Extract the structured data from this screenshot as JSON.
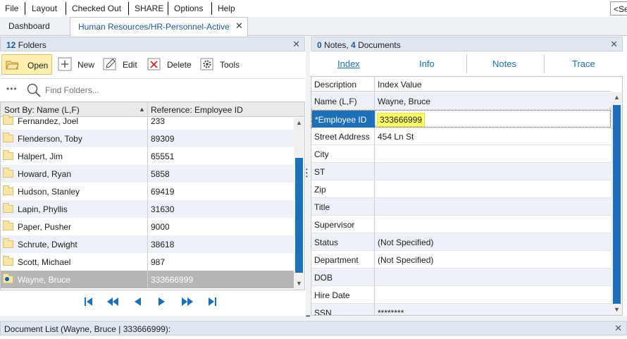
{
  "menu": [
    "File",
    "Layout",
    "Checked Out",
    "SHARE",
    "Options",
    "Help"
  ],
  "search_stub": "<Se",
  "tabs": {
    "dashboard": "Dashboard",
    "active": "Human Resources/HR-Personnel-Active",
    "close": "✕"
  },
  "folders_panel": {
    "count": "12",
    "label": " Folders",
    "close": "✕"
  },
  "toolbar": {
    "open": "Open",
    "new": "New",
    "edit": "Edit",
    "delete": "Delete",
    "tools": "Tools"
  },
  "find": {
    "dots": "•••",
    "placeholder": "Find Folders..."
  },
  "grid": {
    "col1": "Sort By: Name (L,F)",
    "col2": "Reference: Employee ID",
    "rows": [
      {
        "name": "Fernandez, Joel",
        "id": "233"
      },
      {
        "name": "Flenderson, Toby",
        "id": "89309"
      },
      {
        "name": "Halpert, Jim",
        "id": "65551"
      },
      {
        "name": "Howard, Ryan",
        "id": "5858"
      },
      {
        "name": "Hudson, Stanley",
        "id": "69419"
      },
      {
        "name": "Lapin, Phyllis",
        "id": "31630"
      },
      {
        "name": "Paper, Pusher",
        "id": "9000"
      },
      {
        "name": "Schrute, Dwight",
        "id": "38618"
      },
      {
        "name": "Scott, Michael",
        "id": "987"
      },
      {
        "name": "Wayne, Bruce",
        "id": "333666999"
      }
    ]
  },
  "pager": {
    "first": "⇤",
    "prev_page": "«",
    "prev": "◀",
    "next": "▶",
    "next_page": "»",
    "last": "⇥"
  },
  "right_panel": {
    "notes_count": "0",
    "notes_label": " Notes, ",
    "docs_count": "4",
    "docs_label": " Documents",
    "close": "✕"
  },
  "subtabs": [
    "Index",
    "Info",
    "Notes",
    "Trace"
  ],
  "index": {
    "col1": "Description",
    "col2": "Index Value",
    "rows": [
      {
        "label": "Name (L,F)",
        "value": "Wayne, Bruce"
      },
      {
        "label": "*Employee ID",
        "value": "333666999"
      },
      {
        "label": "Street Address",
        "value": "454 Ln St"
      },
      {
        "label": "City",
        "value": ""
      },
      {
        "label": "ST",
        "value": ""
      },
      {
        "label": "Zip",
        "value": ""
      },
      {
        "label": "Title",
        "value": ""
      },
      {
        "label": "Supervisor",
        "value": ""
      },
      {
        "label": "Status",
        "value": "(Not Specified)"
      },
      {
        "label": "Department",
        "value": "(Not Specified)"
      },
      {
        "label": "DOB",
        "value": ""
      },
      {
        "label": "Hire Date",
        "value": ""
      },
      {
        "label": "SSN",
        "value": "********"
      }
    ]
  },
  "doclist": {
    "label": "Document List (Wayne, Bruce | 333666999):",
    "close": "✕"
  },
  "colors": {
    "accent": "#1e6fba",
    "selection": "#1e6fba",
    "highlight": "#ffff66",
    "header_bg": "#dfe7f1"
  }
}
